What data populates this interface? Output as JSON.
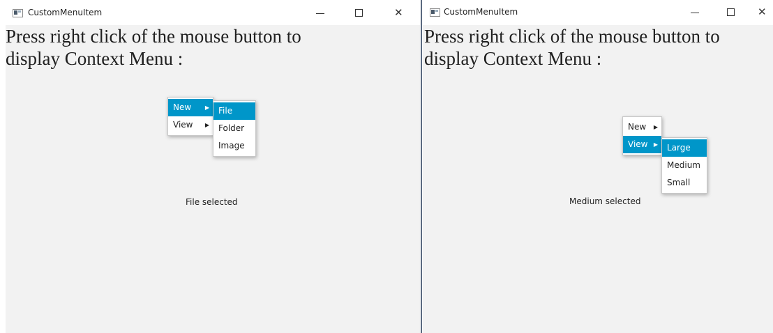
{
  "left_window": {
    "title": "CustomMenuItem",
    "controls": {
      "minimize": "—",
      "maximize": "☐",
      "close": "✕"
    },
    "prompt_line1": "Press right click of the mouse button to",
    "prompt_line2": "display Context Menu :",
    "context_menu": [
      {
        "label": "New",
        "highlighted": true
      },
      {
        "label": "View",
        "highlighted": false
      }
    ],
    "submenu": [
      {
        "label": "File",
        "highlighted": true
      },
      {
        "label": "Folder",
        "highlighted": false
      },
      {
        "label": "Image",
        "highlighted": false
      }
    ],
    "status": "File selected"
  },
  "right_window": {
    "title": "CustomMenuItem",
    "controls": {
      "minimize": "—",
      "maximize": "☐",
      "close": "✕"
    },
    "prompt_line1": "Press right click of the mouse button to",
    "prompt_line2": "display Context Menu :",
    "context_menu": [
      {
        "label": "New",
        "highlighted": false
      },
      {
        "label": "View",
        "highlighted": true
      }
    ],
    "submenu": [
      {
        "label": "Large",
        "highlighted": true
      },
      {
        "label": "Medium",
        "highlighted": false
      },
      {
        "label": "Small",
        "highlighted": false
      }
    ],
    "status": "Medium selected"
  },
  "icons": {
    "submenu_arrow": "▶",
    "app": "app-window-icon"
  },
  "colors": {
    "highlight": "#0096c9",
    "content_bg": "#f2f2f2"
  }
}
